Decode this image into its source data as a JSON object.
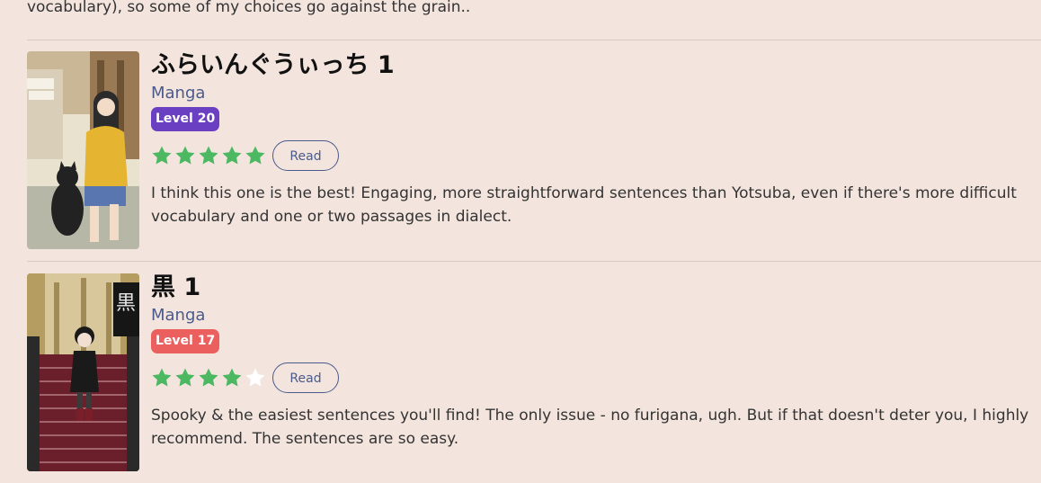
{
  "intro_text": "vocabulary), so some of my choices go against the grain..",
  "read_label": "Read",
  "colors": {
    "background": "#f3e5de",
    "star_filled": "#4cb862",
    "star_empty": "#ffffff",
    "link_blue": "#4a5a8a"
  },
  "entries": [
    {
      "title": "ふらいんぐうぃっち 1",
      "type": "Manga",
      "level": "Level 20",
      "level_color": "#6a3fc1",
      "rating": 5,
      "max_rating": 5,
      "review": "I think this one is the best! Engaging, more straightforward sentences than Yotsuba, even if there's more difficult vocabulary and one or two passages in dialect."
    },
    {
      "title": "黒 1",
      "type": "Manga",
      "level": "Level 17",
      "level_color": "#ec5f5f",
      "rating": 4,
      "max_rating": 5,
      "review": "Spooky & the easiest sentences you'll find! The only issue - no furigana, ugh. But if that doesn't deter you, I highly recommend. The sentences are so easy."
    }
  ]
}
